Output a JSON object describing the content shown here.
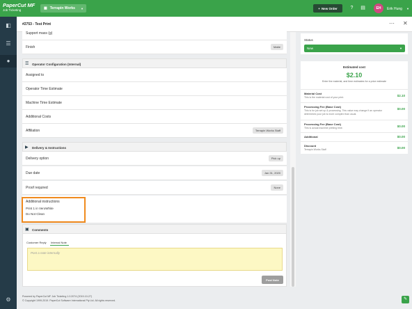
{
  "app": {
    "logo_line1": "PaperCut MF",
    "logo_line2": "Job Ticketing"
  },
  "topbar": {
    "workspace": "Terrapin Works",
    "new_order": "New Order",
    "user_initials": "EH",
    "user_name": "Erik Hung"
  },
  "header": {
    "order_id": "#2753",
    "separator": "-",
    "order_name": "Test Print"
  },
  "top_rows": [
    {
      "label": "Support mass (g)",
      "value": ""
    },
    {
      "label": "Finish",
      "value": "Matte"
    }
  ],
  "operator_section": {
    "title": "Operator Configuration (Internal)",
    "rows": [
      {
        "label": "Assigned to",
        "value": ""
      },
      {
        "label": "Operator Time Estimate",
        "value": ""
      },
      {
        "label": "Machine Time Estimate",
        "value": ""
      },
      {
        "label": "Additional Costs",
        "value": ""
      },
      {
        "label": "Affiliation",
        "value": "Terrapin Works Staff"
      }
    ]
  },
  "delivery_section": {
    "title": "Delivery & Instructions",
    "rows": [
      {
        "label": "Delivery option",
        "value": "Pick up"
      },
      {
        "label": "Due date",
        "value": "Jan 31, 2020"
      },
      {
        "label": "Proof required",
        "value": "None"
      }
    ],
    "additional_instructions_label": "Additional instructions",
    "additional_instructions_lines": [
      "Print 1 in VeroWhite",
      "Do Not Clean"
    ]
  },
  "comments": {
    "title": "Comments",
    "tabs": [
      "Customer Reply",
      "Internal Note"
    ],
    "active_tab": "Internal Note",
    "placeholder": "Post a note internally",
    "post_button": "Post Note"
  },
  "status": {
    "label": "Status",
    "value": "New"
  },
  "estimated_cost": {
    "title": "Estimated cost",
    "amount": "$2.10",
    "hint": "Enter the material, and time estimates for a price estimate",
    "items": [
      {
        "name": "Material Cost",
        "desc": "This is the material cost of your print.",
        "value": "$2.10"
      },
      {
        "name": "Processing Fee (Base Cost)",
        "desc": "This is for job set up & processing. This value may change if an operator determines your job is more complex than usual.",
        "value": "$0.00"
      },
      {
        "name": "Processing Fee (Base Cost)",
        "desc": "This is actual machine printing time.",
        "value": "$0.00"
      },
      {
        "name": "Additional",
        "desc": "",
        "value": "$0.00"
      },
      {
        "name": "Discount",
        "desc": "Terrapin Works Staff",
        "value": "$0.00"
      }
    ]
  },
  "footer": {
    "line1": "Powered by PaperCut MF Job Ticketing 1.0.2074 (2019-10-27)",
    "line2": "© Copyright 1999-2019. PaperCut Software International Pty Ltd. All rights reserved."
  },
  "colors": {
    "brand_green": "#3aa34a",
    "sidebar": "#253b48",
    "highlight": "#f08a1d",
    "avatar": "#d14880"
  },
  "icons": [
    "printer-icon",
    "list-icon",
    "bell-icon",
    "settings-icon",
    "help-icon",
    "chat-icon",
    "plus-icon",
    "close-icon",
    "more-icon"
  ]
}
